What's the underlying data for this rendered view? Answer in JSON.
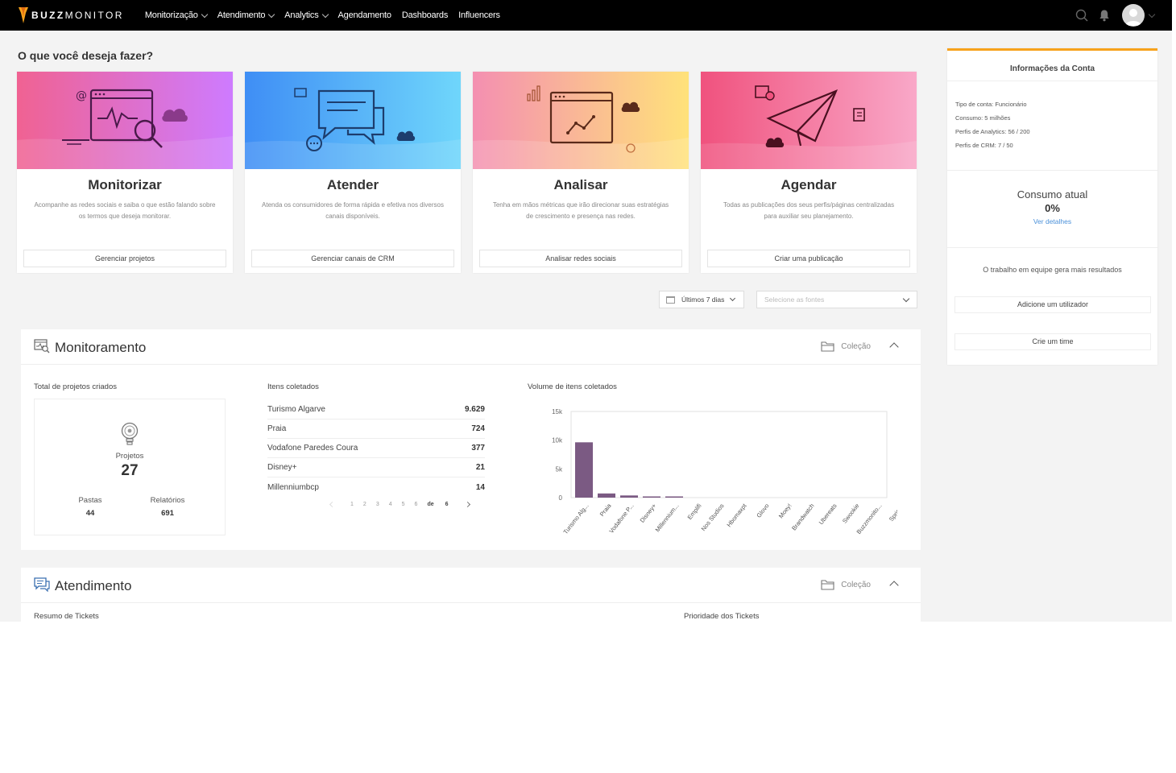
{
  "nav": {
    "brand_bold": "BUZZ",
    "brand_rest": "MONITOR",
    "items": [
      {
        "label": "Monitorização",
        "dropdown": true
      },
      {
        "label": "Atendimento",
        "dropdown": true
      },
      {
        "label": "Analytics",
        "dropdown": true
      },
      {
        "label": "Agendamento",
        "dropdown": false
      },
      {
        "label": "Dashboards",
        "dropdown": false
      },
      {
        "label": "Influencers",
        "dropdown": false
      }
    ]
  },
  "page": {
    "title": "O que você deseja fazer?"
  },
  "cards": [
    {
      "title": "Monitorizar",
      "description": "Acompanhe as redes sociais e saiba o que estão falando sobre os termos que deseja monitorar.",
      "button": "Gerenciar projetos",
      "gradient": [
        "#f06292",
        "#ce7bff"
      ]
    },
    {
      "title": "Atender",
      "description": "Atenda os consumidores de forma rápida e efetiva nos diversos canais disponíveis.",
      "button": "Gerenciar canais de CRM",
      "gradient": [
        "#3f8ef5",
        "#6fd6fb"
      ]
    },
    {
      "title": "Analisar",
      "description": "Tenha em mãos métricas que irão direcionar suas estratégias de crescimento e presença nas redes.",
      "button": "Analisar redes sociais",
      "gradient": [
        "#f48fb1",
        "#ffe27a"
      ]
    },
    {
      "title": "Agendar",
      "description": "Todas as publicações dos seus perfis/páginas centralizadas para auxiliar seu planejamento.",
      "button": "Criar uma publicação",
      "gradient": [
        "#f0527e",
        "#f9a8c8"
      ]
    }
  ],
  "filters": {
    "period": "Últimos 7 dias",
    "sources_placeholder": "Selecione as fontes"
  },
  "monitoramento": {
    "title": "Monitoramento",
    "collection": "Coleção",
    "projects_heading": "Total de projetos criados",
    "projects_label": "Projetos",
    "projects_value": "27",
    "folders_label": "Pastas",
    "folders_value": "44",
    "reports_label": "Relatórios",
    "reports_value": "691",
    "items_heading": "Itens coletados",
    "items": [
      {
        "name": "Turismo Algarve",
        "count": "9.629"
      },
      {
        "name": "Praia",
        "count": "724"
      },
      {
        "name": "Vodafone Paredes Coura",
        "count": "377"
      },
      {
        "name": "Disney+",
        "count": "21"
      },
      {
        "name": "Millenniumbcp",
        "count": "14"
      }
    ],
    "pager": {
      "pages": [
        "1",
        "2",
        "3",
        "4",
        "5",
        "6"
      ],
      "of_label": "de",
      "total": "6"
    },
    "volume_heading": "Volume de itens coletados"
  },
  "atendimento": {
    "title": "Atendimento",
    "collection": "Coleção",
    "tickets_summary": "Resumo de Tickets",
    "tickets_priority": "Prioridade dos Tickets"
  },
  "account": {
    "title": "Informações da Conta",
    "lines": [
      {
        "label": "Tipo de conta:",
        "value": "Funcionário"
      },
      {
        "label": "Consumo:",
        "value": "5 milhões"
      },
      {
        "label": "Perfis de Analytics:",
        "value": "56 / 200"
      },
      {
        "label": "Perfis de CRM:",
        "value": "7 / 50"
      }
    ],
    "consumo_title": "Consumo atual",
    "consumo_value": "0%",
    "consumo_link": "Ver detalhes",
    "team_text": "O trabalho em equipe gera mais resultados",
    "add_user": "Adicione um utilizador",
    "create_team": "Crie um time",
    "accent": "#f7a21b"
  },
  "chart_data": {
    "type": "bar",
    "categories": [
      "Turismo Alg...",
      "Praia",
      "Vodafone P...",
      "Disney+",
      "Millennium...",
      "Emplifi",
      "Nos Studios",
      "Hbomaxpt",
      "Glovo",
      "Moey!",
      "Brandwatch",
      "Ubereats",
      "Swookie",
      "Buzzmonito...",
      "Sprinklr"
    ],
    "values": [
      9629,
      724,
      377,
      21,
      14,
      0,
      0,
      0,
      0,
      0,
      0,
      0,
      0,
      0,
      0
    ],
    "yticks": [
      "0",
      "5k",
      "10k",
      "15k"
    ],
    "ylim": [
      0,
      15000
    ],
    "color": "#7b5a83",
    "grid": false
  }
}
